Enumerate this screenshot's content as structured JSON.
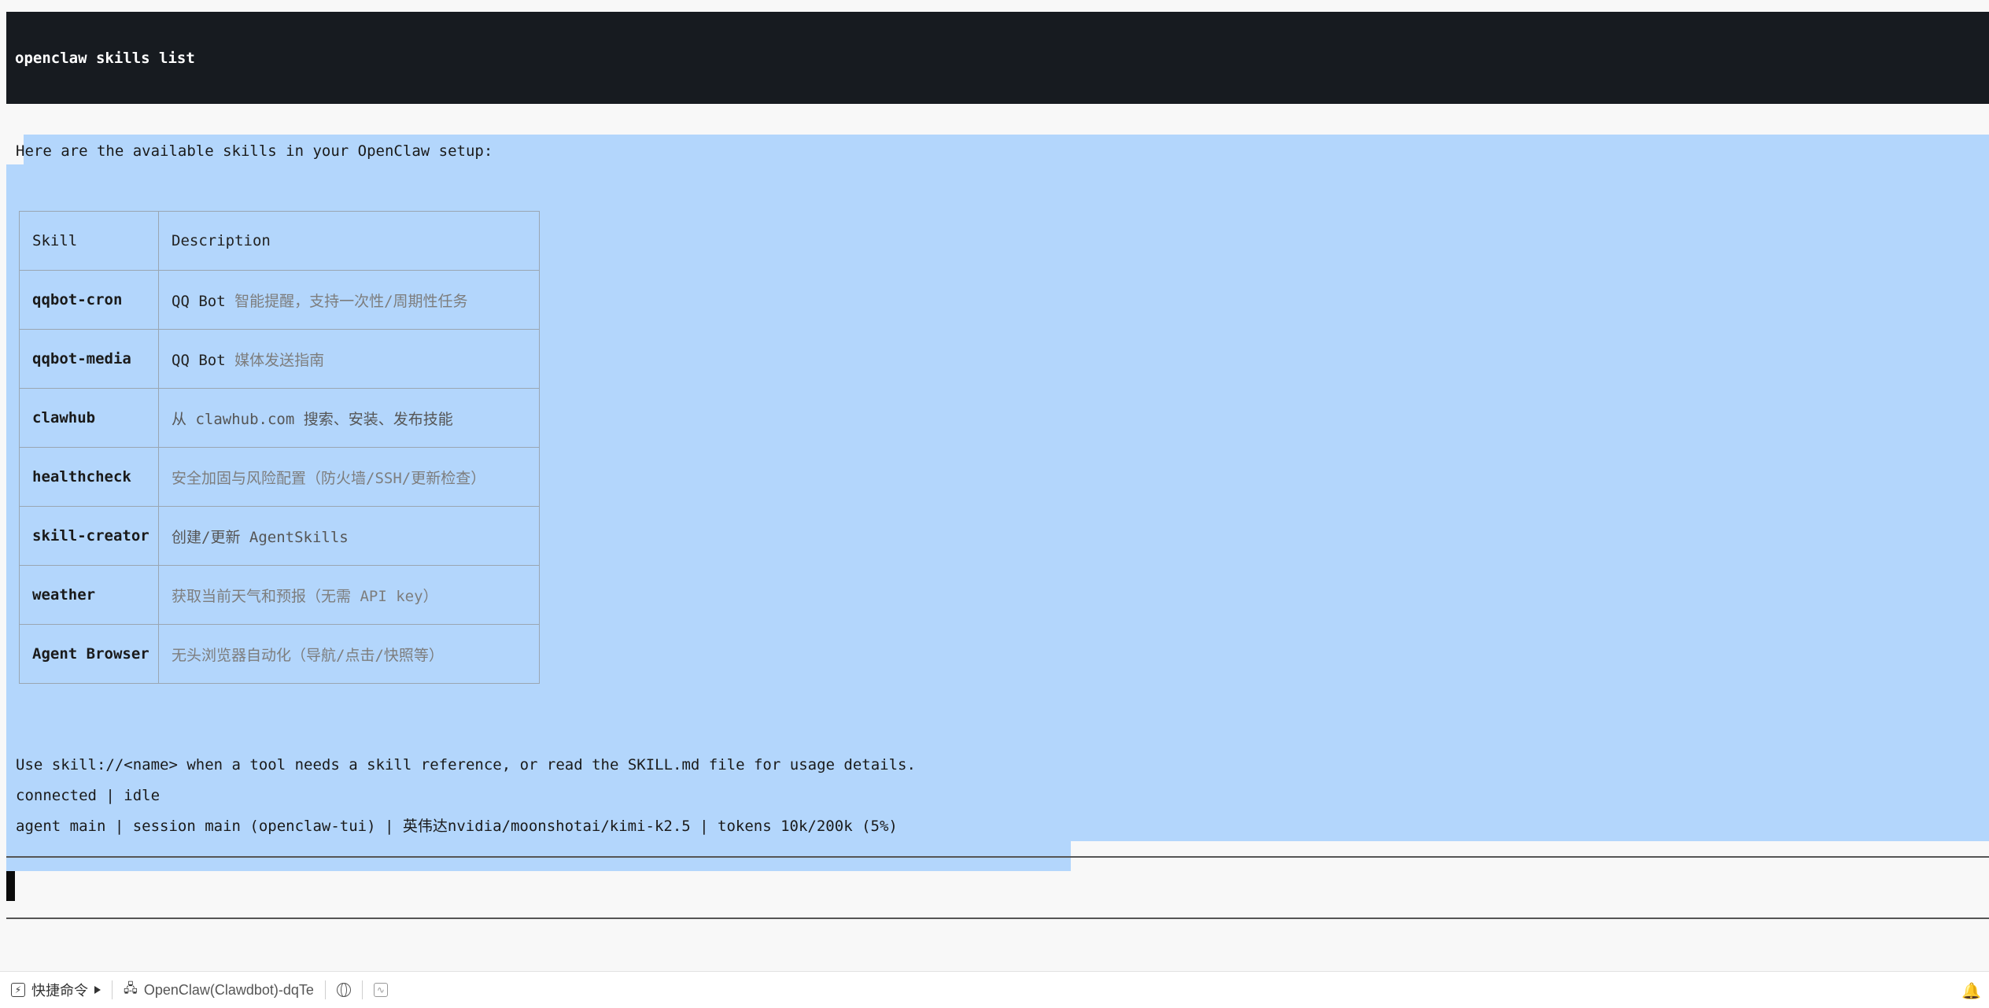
{
  "terminal": {
    "command": "openclaw skills list",
    "intro": "Here are the available skills in your OpenClaw setup:",
    "table": {
      "headers": [
        "Skill",
        "Description"
      ],
      "rows": [
        {
          "skill": "qqbot-cron",
          "desc_prefix": "QQ Bot ",
          "desc_rest": "智能提醒，支持一次性/周期性任务"
        },
        {
          "skill": "qqbot-media",
          "desc_prefix": "QQ Bot ",
          "desc_rest": "媒体发送指南"
        },
        {
          "skill": "clawhub",
          "desc_prefix": "",
          "desc_rest": "从 clawhub.com 搜索、安装、发布技能"
        },
        {
          "skill": "healthcheck",
          "desc_prefix": "",
          "desc_rest": "安全加固与风险配置（防火墙/SSH/更新检查）"
        },
        {
          "skill": "skill-creator",
          "desc_prefix": "",
          "desc_rest": "创建/更新 AgentSkills"
        },
        {
          "skill": "weather",
          "desc_prefix": "",
          "desc_rest": "获取当前天气和预报（无需 API key）"
        },
        {
          "skill": "Agent Browser",
          "desc_prefix": "",
          "desc_rest": "无头浏览器自动化（导航/点击/快照等）"
        }
      ]
    },
    "usage_note": "Use skill://<name> when a tool needs a skill reference, or read the SKILL.md file for usage details.",
    "status_line": "connected | idle",
    "agent_line": "agent main | session main (openclaw-tui) | 英伟达nvidia/moonshotai/kimi-k2.5 | tokens 10k/200k (5%)"
  },
  "taskbar": {
    "quick_commands": "快捷命令",
    "session_name": "OpenClaw(Clawdbot)-dqTe",
    "icons": [
      "lightning-icon",
      "play-arrow-icon",
      "server-icon",
      "globe-icon",
      "monitor-chart-icon",
      "bell-icon"
    ]
  }
}
